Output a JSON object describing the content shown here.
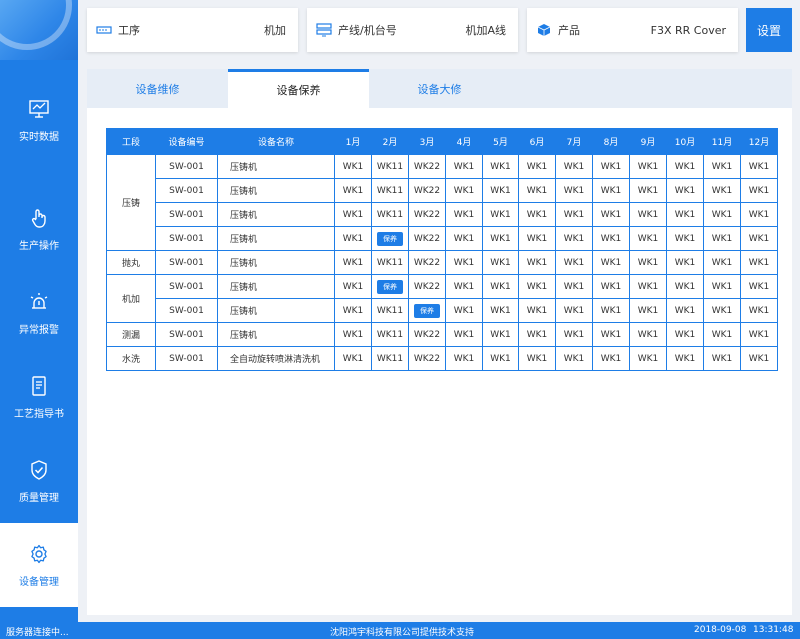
{
  "sidebar": {
    "items": [
      {
        "label": "实时数据",
        "icon": "monitor-icon"
      },
      {
        "label": "生产操作",
        "icon": "hand-pointer-icon"
      },
      {
        "label": "异常报警",
        "icon": "alarm-light-icon"
      },
      {
        "label": "工艺指导书",
        "icon": "document-icon"
      },
      {
        "label": "质量管理",
        "icon": "shield-check-icon"
      },
      {
        "label": "设备管理",
        "icon": "gear-icon"
      }
    ],
    "active_index": 5
  },
  "header": {
    "process": {
      "label": "工序",
      "value": "机加",
      "icon": "process-icon"
    },
    "line": {
      "label": "产线/机台号",
      "value": "机加A线",
      "icon": "server-icon"
    },
    "product": {
      "label": "产品",
      "value": "F3X RR Cover",
      "icon": "cube-icon"
    },
    "settings_label": "设置"
  },
  "tabs": [
    {
      "label": "设备维修"
    },
    {
      "label": "设备保养"
    },
    {
      "label": "设备大修"
    }
  ],
  "active_tab": 1,
  "table": {
    "headers": [
      "工段",
      "设备编号",
      "设备名称",
      "1月",
      "2月",
      "3月",
      "4月",
      "5月",
      "6月",
      "7月",
      "8月",
      "9月",
      "10月",
      "11月",
      "12月"
    ],
    "groups": [
      {
        "section": "压铸",
        "rows": [
          {
            "code": "SW-001",
            "name": "压铸机",
            "cells": [
              {
                "t": "WK1",
                "c": "green"
              },
              {
                "t": "WK11",
                "c": "green"
              },
              {
                "t": "WK22",
                "c": "green"
              },
              {
                "t": "WK1"
              },
              {
                "t": "WK1"
              },
              {
                "t": "WK1"
              },
              {
                "t": "WK1"
              },
              {
                "t": "WK1"
              },
              {
                "t": "WK1"
              },
              {
                "t": "WK1"
              },
              {
                "t": "WK1"
              },
              {
                "t": "WK1"
              }
            ]
          },
          {
            "code": "SW-001",
            "name": "压铸机",
            "cells": [
              {
                "t": "WK1",
                "c": "green"
              },
              {
                "t": "WK11",
                "c": "green"
              },
              {
                "t": "WK22",
                "c": "green"
              },
              {
                "t": "WK1"
              },
              {
                "t": "WK1"
              },
              {
                "t": "WK1"
              },
              {
                "t": "WK1"
              },
              {
                "t": "WK1"
              },
              {
                "t": "WK1"
              },
              {
                "t": "WK1"
              },
              {
                "t": "WK1"
              },
              {
                "t": "WK1"
              }
            ]
          },
          {
            "code": "SW-001",
            "name": "压铸机",
            "cells": [
              {
                "t": "WK1",
                "c": "green"
              },
              {
                "t": "WK11",
                "c": "green"
              },
              {
                "t": "WK22",
                "c": "green"
              },
              {
                "t": "WK1"
              },
              {
                "t": "WK1"
              },
              {
                "t": "WK1"
              },
              {
                "t": "WK1"
              },
              {
                "t": "WK1"
              },
              {
                "t": "WK1"
              },
              {
                "t": "WK1"
              },
              {
                "t": "WK1"
              },
              {
                "t": "WK1"
              }
            ]
          },
          {
            "code": "SW-001",
            "name": "压铸机",
            "cells": [
              {
                "t": "WK1",
                "c": "green"
              },
              {
                "t": "保养",
                "c": "badge"
              },
              {
                "t": "WK22",
                "c": "green"
              },
              {
                "t": "WK1"
              },
              {
                "t": "WK1"
              },
              {
                "t": "WK1"
              },
              {
                "t": "WK1"
              },
              {
                "t": "WK1"
              },
              {
                "t": "WK1"
              },
              {
                "t": "WK1"
              },
              {
                "t": "WK1"
              },
              {
                "t": "WK1"
              }
            ]
          }
        ]
      },
      {
        "section": "抛丸",
        "rows": [
          {
            "code": "SW-001",
            "name": "压铸机",
            "cells": [
              {
                "t": "WK1",
                "c": "green"
              },
              {
                "t": "WK11",
                "c": "red"
              },
              {
                "t": "WK22",
                "c": "green"
              },
              {
                "t": "WK1"
              },
              {
                "t": "WK1"
              },
              {
                "t": "WK1"
              },
              {
                "t": "WK1"
              },
              {
                "t": "WK1"
              },
              {
                "t": "WK1"
              },
              {
                "t": "WK1"
              },
              {
                "t": "WK1"
              },
              {
                "t": "WK1"
              }
            ]
          }
        ]
      },
      {
        "section": "机加",
        "rows": [
          {
            "code": "SW-001",
            "name": "压铸机",
            "cells": [
              {
                "t": "WK1",
                "c": "green"
              },
              {
                "t": "保养",
                "c": "badge"
              },
              {
                "t": "WK22",
                "c": "green"
              },
              {
                "t": "WK1"
              },
              {
                "t": "WK1"
              },
              {
                "t": "WK1"
              },
              {
                "t": "WK1"
              },
              {
                "t": "WK1"
              },
              {
                "t": "WK1"
              },
              {
                "t": "WK1"
              },
              {
                "t": "WK1"
              },
              {
                "t": "WK1"
              }
            ]
          },
          {
            "code": "SW-001",
            "name": "压铸机",
            "cells": [
              {
                "t": "WK1",
                "c": "green"
              },
              {
                "t": "WK11",
                "c": "green"
              },
              {
                "t": "保养",
                "c": "badge"
              },
              {
                "t": "WK1"
              },
              {
                "t": "WK1"
              },
              {
                "t": "WK1"
              },
              {
                "t": "WK1"
              },
              {
                "t": "WK1"
              },
              {
                "t": "WK1"
              },
              {
                "t": "WK1"
              },
              {
                "t": "WK1"
              },
              {
                "t": "WK1"
              }
            ]
          }
        ]
      },
      {
        "section": "测漏",
        "rows": [
          {
            "code": "SW-001",
            "name": "压铸机",
            "cells": [
              {
                "t": "WK1",
                "c": "green"
              },
              {
                "t": "WK11",
                "c": "green"
              },
              {
                "t": "WK22",
                "c": "red"
              },
              {
                "t": "WK1"
              },
              {
                "t": "WK1"
              },
              {
                "t": "WK1"
              },
              {
                "t": "WK1"
              },
              {
                "t": "WK1"
              },
              {
                "t": "WK1"
              },
              {
                "t": "WK1"
              },
              {
                "t": "WK1"
              },
              {
                "t": "WK1"
              }
            ]
          }
        ]
      },
      {
        "section": "水洗",
        "rows": [
          {
            "code": "SW-001",
            "name": "全自动旋转喷淋清洗机",
            "cells": [
              {
                "t": "WK1",
                "c": "green"
              },
              {
                "t": "WK11",
                "c": "green"
              },
              {
                "t": "WK22",
                "c": "red"
              },
              {
                "t": "WK1"
              },
              {
                "t": "WK1"
              },
              {
                "t": "WK1"
              },
              {
                "t": "WK1"
              },
              {
                "t": "WK1"
              },
              {
                "t": "WK1"
              },
              {
                "t": "WK1"
              },
              {
                "t": "WK1"
              },
              {
                "t": "WK1"
              }
            ]
          }
        ]
      }
    ]
  },
  "status": {
    "connection": "服务器连接中...",
    "support": "沈阳鸿宇科技有限公司提供技术支持",
    "date": "2018-09-08",
    "time": "13:31:48"
  },
  "colors": {
    "primary": "#1e7de6",
    "green": "#44cc3a",
    "red": "#e02020"
  }
}
